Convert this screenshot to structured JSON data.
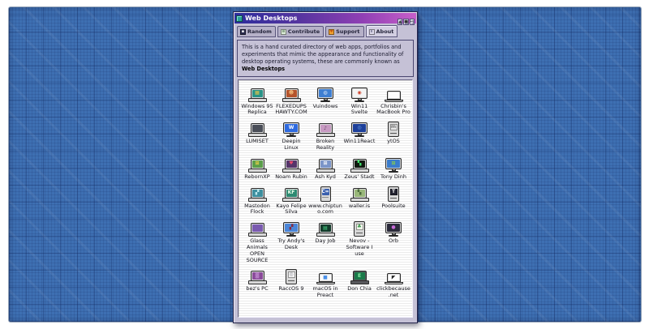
{
  "window": {
    "title": "Web Desktops",
    "controls": [
      {
        "name": "minimize",
        "glyph": "▲"
      },
      {
        "name": "maximize",
        "glyph": "■"
      },
      {
        "name": "close",
        "glyph": "↵"
      }
    ]
  },
  "tabs": [
    {
      "label": "Random",
      "active": false,
      "icon": "dice-icon",
      "icon_bg": "#2c2c4e",
      "icon_glyph": "▪",
      "icon_glyph_color": "#ffffff"
    },
    {
      "label": "Contribute",
      "active": false,
      "icon": "document-icon",
      "icon_bg": "#dcecd8",
      "icon_glyph": "≡",
      "icon_glyph_color": "#5a7a5a"
    },
    {
      "label": "Support",
      "active": false,
      "icon": "heart-icon",
      "icon_bg": "#f0a030",
      "icon_glyph": "♥",
      "icon_glyph_color": "#c85a10"
    },
    {
      "label": "About",
      "active": true,
      "icon": "info-icon",
      "icon_bg": "#dcd8ea",
      "icon_glyph": "i",
      "icon_glyph_color": "#33335a"
    }
  ],
  "description": {
    "text": "This is a hand curated directory of web apps, portfolios and experiments that mimic the appearance and functionality of desktop operating systems, these are commonly known as ",
    "bold_text": "Web Desktops"
  },
  "icons": [
    {
      "label": "Windows 95 Replica",
      "type": "desktop",
      "screen": "#2a9488",
      "glyph": "▦",
      "glyph_color": "#e8c84a"
    },
    {
      "label": "FLEXEDUPS HAWTY.COM",
      "type": "desktop",
      "screen": "#b5542c",
      "glyph": "☻",
      "glyph_color": "#f0b878"
    },
    {
      "label": "Vuindows",
      "type": "monitor",
      "screen": "#3f7fd2",
      "glyph": "◍",
      "glyph_color": "#d8e6f8"
    },
    {
      "label": "Win11 Svelte",
      "type": "monitor",
      "screen": "#f4f4f4",
      "glyph": "◉",
      "glyph_color": "#d04028"
    },
    {
      "label": "Chrisbin's MacBook Pro",
      "type": "laptop",
      "screen": "#fcfcfc",
      "glyph": "",
      "glyph_color": ""
    },
    {
      "label": "LUMISET",
      "type": "desktop",
      "screen": "#4a4e58",
      "glyph": "",
      "glyph_color": ""
    },
    {
      "label": "Deepin Linux",
      "type": "monitor",
      "screen": "#2f6be0",
      "glyph": "W",
      "glyph_color": "#ffffff"
    },
    {
      "label": "Broken Reality",
      "type": "desktop",
      "screen": "#c79ac2",
      "glyph": "♪",
      "glyph_color": "#5a3a5a"
    },
    {
      "label": "Win11React",
      "type": "monitor",
      "screen": "#1d3f9a",
      "glyph": "◎",
      "glyph_color": "#6fa8e8"
    },
    {
      "label": "ytOS",
      "type": "compact",
      "screen": "#e8e8e8",
      "glyph": "m",
      "glyph_color": "#777777"
    },
    {
      "label": "RebornXP",
      "type": "desktop",
      "screen": "#5a9e4a",
      "glyph": "⊞",
      "glyph_color": "#f8d44c"
    },
    {
      "label": "Noam Rubin",
      "type": "desktop",
      "screen": "#55356a",
      "glyph": "♥",
      "glyph_color": "#e84a6a"
    },
    {
      "label": "Ash Kyd",
      "type": "desktop",
      "screen": "#7a94c8",
      "glyph": "⊞",
      "glyph_color": "#ffffff"
    },
    {
      "label": "Zeus' Stadt",
      "type": "desktop",
      "screen": "#10180f",
      "glyph": "▚",
      "glyph_color": "#3fe06a"
    },
    {
      "label": "Tony Dinh",
      "type": "monitor",
      "screen": "#3a7ccc",
      "glyph": "⊞",
      "glyph_color": "#8ad04a"
    },
    {
      "label": "Mastodon Flock",
      "type": "desktop",
      "screen": "#3d8f9f",
      "glyph": "▞",
      "glyph_color": "#bce8ee"
    },
    {
      "label": "Kayo Felipe Silva",
      "type": "desktop",
      "screen": "#2e8a72",
      "glyph": "KF",
      "glyph_color": "#eaffea"
    },
    {
      "label": "www.chiptuno.com",
      "type": "tower",
      "screen": "#3a5fae",
      "glyph": "C=",
      "glyph_color": "#ffffff"
    },
    {
      "label": "waller.is",
      "type": "desktop",
      "screen": "#9ab87a",
      "glyph": "▚",
      "glyph_color": "#4a6a3a"
    },
    {
      "label": "Poolsuite",
      "type": "compact",
      "screen": "#222230",
      "glyph": "T",
      "glyph_color": "#f0f0f0"
    },
    {
      "label": "Glass Animals OPEN SOURCE",
      "type": "desktop",
      "screen": "#7a5ab0",
      "glyph": "",
      "glyph_color": ""
    },
    {
      "label": "Try Andy's Desk",
      "type": "monitor",
      "screen": "#4a86d8",
      "glyph": "▞",
      "glyph_color": "#8a2a3a"
    },
    {
      "label": "Day Job",
      "type": "desktop",
      "screen": "#123a2a",
      "glyph": "▤",
      "glyph_color": "#48d888"
    },
    {
      "label": "Nevov - Software I use",
      "type": "compact",
      "screen": "#f0f4ea",
      "glyph": "♣",
      "glyph_color": "#3a9a4a"
    },
    {
      "label": "Orb",
      "type": "monitor",
      "screen": "#2a2a3a",
      "glyph": "●",
      "glyph_color": "#c86ad8"
    },
    {
      "label": "bez's PC",
      "type": "desktop",
      "screen": "#8a4a9a",
      "glyph": "▒",
      "glyph_color": "#d8a8e8"
    },
    {
      "label": "RaccOS 9",
      "type": "compact",
      "screen": "#f4f4f4",
      "glyph": "◎",
      "glyph_color": "#8a8a92"
    },
    {
      "label": "macOS in Preact",
      "type": "laptop",
      "screen": "#fafafa",
      "glyph": "■",
      "glyph_color": "#4a90e8"
    },
    {
      "label": "Don Chia",
      "type": "desktop",
      "screen": "#1a7a4a",
      "glyph": "E",
      "glyph_color": "#8af0a8",
      "body": "#5a5a5e"
    },
    {
      "label": "clickbecause.net",
      "type": "laptop",
      "screen": "#ffffff",
      "glyph": "◤",
      "glyph_color": "#222222"
    }
  ],
  "colors": {
    "desktop_grid": "#3e6fb2",
    "window_chrome": "#c5c1d6",
    "titlebar_gradient_start": "#2c2c9c",
    "titlebar_gradient_end": "#c75fc9"
  }
}
